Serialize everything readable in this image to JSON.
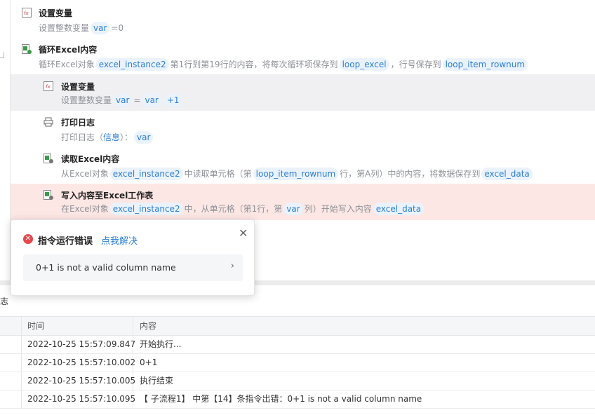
{
  "steps": [
    {
      "title": "设置变量",
      "desc": [
        "设置整数变量",
        "var",
        "=0"
      ]
    },
    {
      "title": "循环Excel内容",
      "desc": [
        "循环Excel对象",
        "excel_instance2",
        "第1行到第19行的内容，将每次循环项保存到",
        "loop_excel",
        "，行号保存到",
        "loop_item_rownum"
      ]
    },
    {
      "title": "设置变量",
      "desc": [
        "设置整数变量",
        "var",
        "=",
        "var",
        "+1"
      ]
    },
    {
      "title": "打印日志",
      "desc": [
        "打印日志（",
        "信息",
        "）：",
        "var"
      ]
    },
    {
      "title": "读取Excel内容",
      "desc": [
        "从Excel对象",
        "excel_instance2",
        "中读取单元格（第",
        "loop_item_rownum",
        "行，第A列）中的内容，将数据保存到",
        "excel_data"
      ]
    },
    {
      "title": "写入内容至Excel工作表",
      "desc": [
        "在Excel对象",
        "excel_instance2",
        "中，从单元格（第1行，第",
        "var",
        "列）开始写入内容",
        "excel_data"
      ]
    }
  ],
  "popup": {
    "title": "指令运行错误",
    "link": "点我解决",
    "message": "0+1 is not a valid column name"
  },
  "log": {
    "label": "志",
    "headers": {
      "time": "时间",
      "content": "内容"
    },
    "rows": [
      {
        "time": "2022-10-25 15:57:09.847",
        "content": "开始执行..."
      },
      {
        "time": "2022-10-25 15:57:10.002",
        "content": "0+1"
      },
      {
        "time": "2022-10-25 15:57:10.005",
        "content": "执行结束"
      },
      {
        "time": "2022-10-25 15:57:10.095",
        "content": "【 子流程1】 中第【14】条指令出错：0+1 is not a valid column name"
      }
    ]
  }
}
